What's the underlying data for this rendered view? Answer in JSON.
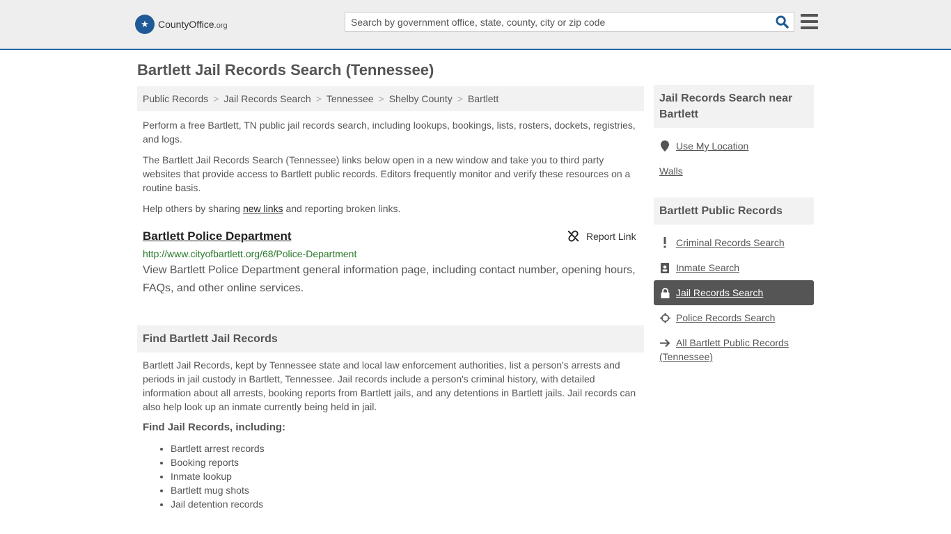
{
  "header": {
    "logo_main": "CountyOffice",
    "logo_org": ".org",
    "search_placeholder": "Search by government office, state, county, city or zip code"
  },
  "page": {
    "title": "Bartlett Jail Records Search (Tennessee)"
  },
  "breadcrumb": [
    "Public Records",
    "Jail Records Search",
    "Tennessee",
    "Shelby County",
    "Bartlett"
  ],
  "intro": {
    "p1": "Perform a free Bartlett, TN public jail records search, including lookups, bookings, lists, rosters, dockets, registries, and logs.",
    "p2": "The Bartlett Jail Records Search (Tennessee) links below open in a new window and take you to third party websites that provide access to Bartlett public records. Editors frequently monitor and verify these resources on a routine basis.",
    "p3_before": "Help others by sharing ",
    "p3_link": "new links",
    "p3_after": " and reporting broken links."
  },
  "listing": {
    "title": "Bartlett Police Department",
    "report_label": "Report Link",
    "url": "http://www.cityofbartlett.org/68/Police-Department",
    "description": "View Bartlett Police Department general information page, including contact number, opening hours, FAQs, and other online services."
  },
  "find_section": {
    "heading": "Find Bartlett Jail Records",
    "text": "Bartlett Jail Records, kept by Tennessee state and local law enforcement authorities, list a person's arrests and periods in jail custody in Bartlett, Tennessee. Jail records include a person's criminal history, with detailed information about all arrests, booking reports from Bartlett jails, and any detentions in Bartlett jails. Jail records can also help look up an inmate currently being held in jail.",
    "subheading": "Find Jail Records, including:",
    "items": [
      "Bartlett arrest records",
      "Booking reports",
      "Inmate lookup",
      "Bartlett mug shots",
      "Jail detention records"
    ]
  },
  "sidebar": {
    "near_heading": "Jail Records Search near Bartlett",
    "use_location": "Use My Location",
    "nearby": "Walls",
    "records_heading": "Bartlett Public Records",
    "links": [
      {
        "label": "Criminal Records Search",
        "icon": "exclamation-icon"
      },
      {
        "label": "Inmate Search",
        "icon": "id-badge-icon"
      },
      {
        "label": "Jail Records Search",
        "icon": "lock-icon"
      },
      {
        "label": "Police Records Search",
        "icon": "crosshair-icon"
      },
      {
        "label": "All Bartlett Public Records (Tennessee)",
        "icon": "arrow-right-icon"
      }
    ]
  },
  "colors": {
    "brand_blue": "#2a69a8",
    "url_green": "#2a7a2a",
    "active_item": "#555555"
  }
}
